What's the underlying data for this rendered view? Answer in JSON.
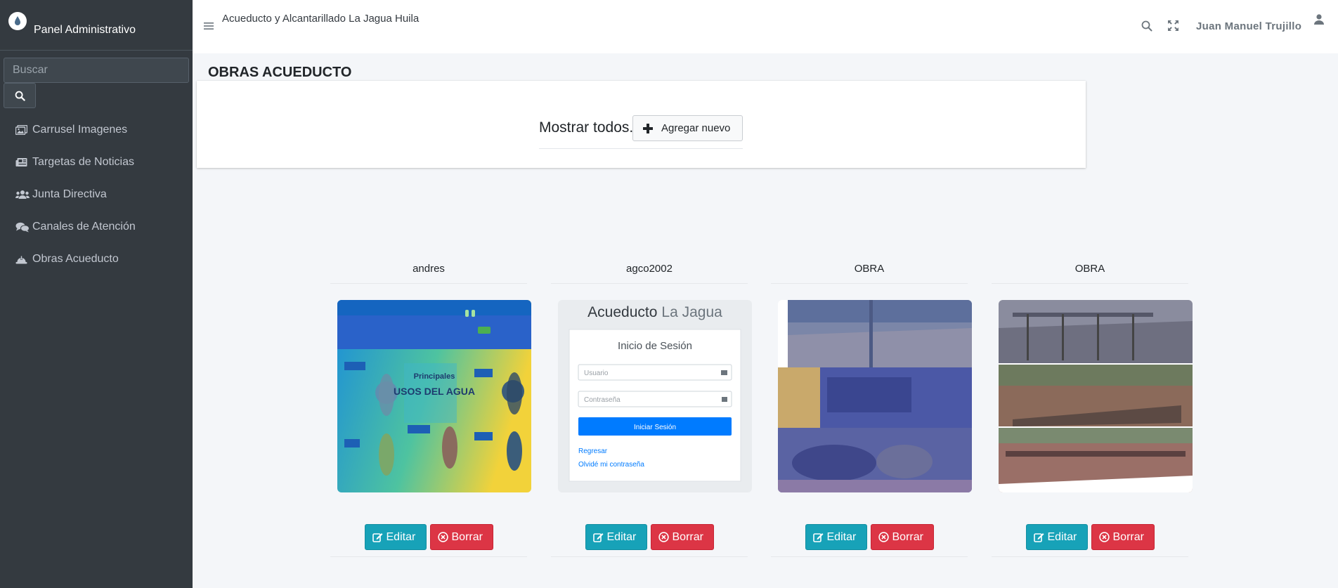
{
  "sidebar": {
    "brand": "Panel Administrativo",
    "search_placeholder": "Buscar",
    "items": [
      {
        "label": "Carrusel Imagenes",
        "icon": "images-icon"
      },
      {
        "label": "Targetas de Noticias",
        "icon": "newspaper-icon"
      },
      {
        "label": "Junta Directiva",
        "icon": "users-icon"
      },
      {
        "label": "Canales de Atención",
        "icon": "comments-icon"
      },
      {
        "label": "Obras Acueducto",
        "icon": "hard-hat-icon"
      }
    ]
  },
  "topbar": {
    "site_title": "Acueducto y Alcantarillado La Jagua Huila",
    "user_name": "Juan Manuel Trujillo"
  },
  "main": {
    "page_title": "OBRAS ACUEDUCTO",
    "show_all": "Mostrar todos.",
    "add_label": "Agregar nuevo",
    "items": [
      {
        "name": "andres",
        "edit": "Editar",
        "delete": "Borrar"
      },
      {
        "name": "agco2002",
        "edit": "Editar",
        "delete": "Borrar"
      },
      {
        "name": "OBRA",
        "edit": "Editar",
        "delete": "Borrar"
      },
      {
        "name": "OBRA",
        "edit": "Editar",
        "delete": "Borrar"
      }
    ]
  },
  "login_thumb": {
    "brand_a": "Acueducto",
    "brand_b": "La Jagua",
    "title": "Inicio de Sesión",
    "user_placeholder": "Usuario",
    "pass_placeholder": "Contraseña",
    "button": "Iniciar Sesión",
    "link_back": "Regresar",
    "link_forgot": "Olvidé mi contraseña"
  },
  "poster_thumb": {
    "heading_a": "Principales",
    "heading_b": "USOS DEL AGUA"
  },
  "colors": {
    "sidebar_bg": "#343a40",
    "edit_btn": "#17a2b8",
    "delete_btn": "#dc3545",
    "primary": "#007bff"
  }
}
